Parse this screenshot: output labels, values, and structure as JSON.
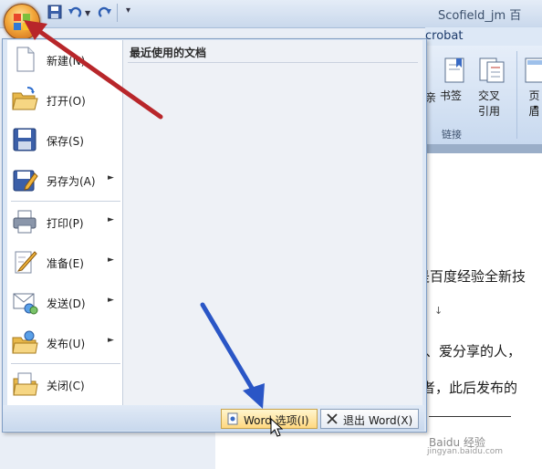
{
  "window": {
    "title": "Scofield_jm 百"
  },
  "office_button": {
    "icon": "office-logo-icon"
  },
  "quick_access": {
    "icons": [
      "save-icon",
      "undo-icon",
      "redo-icon",
      "customize-icon"
    ]
  },
  "ribbon": {
    "tab_fragment": "crobat",
    "bookmark_label": "书签",
    "cross_ref_line1": "交叉",
    "cross_ref_line2": "引用",
    "page_label": "页眉",
    "links_group": "链接"
  },
  "menu": {
    "recent_title": "最近使用的文档",
    "items": [
      {
        "label": "新建(N)",
        "icon": "new-document-icon",
        "submenu": false
      },
      {
        "label": "打开(O)",
        "icon": "open-folder-icon",
        "submenu": false
      },
      {
        "label": "保存(S)",
        "icon": "save-icon",
        "submenu": false
      },
      {
        "label": "另存为(A)",
        "icon": "save-as-icon",
        "submenu": true
      },
      {
        "label": "打印(P)",
        "icon": "printer-icon",
        "submenu": true
      },
      {
        "label": "准备(E)",
        "icon": "prepare-icon",
        "submenu": true
      },
      {
        "label": "发送(D)",
        "icon": "send-icon",
        "submenu": true
      },
      {
        "label": "发布(U)",
        "icon": "publish-icon",
        "submenu": true
      },
      {
        "label": "关闭(C)",
        "icon": "close-folder-icon",
        "submenu": false
      }
    ],
    "submenu_arrow": "►",
    "options_button": "Word 选项(I)",
    "exit_button": "退出 Word(X)"
  },
  "document": {
    "line1": "是百度经验全新技",
    "line2": "↓",
    "line3": "、爱分享的人，",
    "line4": "者，此后发布的"
  },
  "watermark": {
    "line1": "Baidu 经验",
    "line2": "jingyan.baidu.com"
  },
  "colors": {
    "annotation_red": "#b8262a",
    "annotation_blue": "#2a56c6"
  }
}
